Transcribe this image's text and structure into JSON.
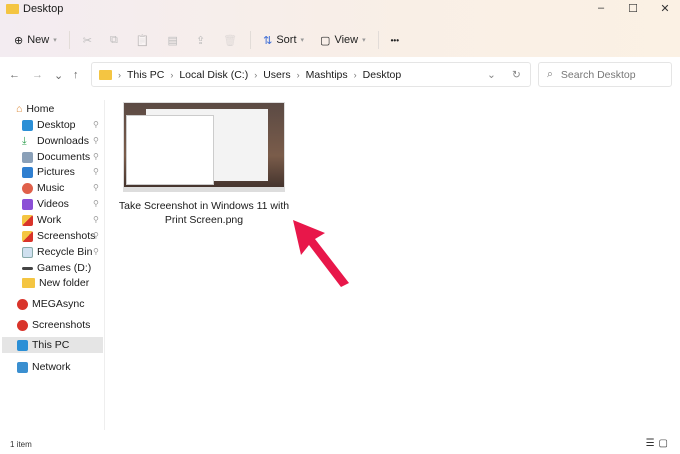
{
  "window": {
    "title": "Desktop",
    "minimize": "–",
    "maximize": "☐",
    "close": "✕"
  },
  "toolbar": {
    "new_label": "New",
    "sort_label": "Sort",
    "view_label": "View",
    "more": "•••",
    "cut": "✂",
    "copy": "⧉",
    "paste": "📋",
    "rename": "▤",
    "share": "⇪",
    "delete": "🗑"
  },
  "nav": {
    "back": "←",
    "forward": "→",
    "recent": "⌄",
    "up": "↑"
  },
  "address": {
    "crumbs": [
      "This PC",
      "Local Disk (C:)",
      "Users",
      "Mashtips",
      "Desktop"
    ],
    "dropdown": "⌄",
    "refresh": "↻"
  },
  "search": {
    "placeholder": "Search Desktop"
  },
  "sidebar": {
    "items": [
      {
        "label": "Home",
        "pinned": false
      },
      {
        "label": "Desktop",
        "pinned": true
      },
      {
        "label": "Downloads",
        "pinned": true
      },
      {
        "label": "Documents",
        "pinned": true
      },
      {
        "label": "Pictures",
        "pinned": true
      },
      {
        "label": "Music",
        "pinned": true
      },
      {
        "label": "Videos",
        "pinned": true
      },
      {
        "label": "Work",
        "pinned": true
      },
      {
        "label": "Screenshots",
        "pinned": true
      },
      {
        "label": "Recycle Bin",
        "pinned": true
      },
      {
        "label": "Games (D:)",
        "pinned": false
      },
      {
        "label": "New folder",
        "pinned": false
      },
      {
        "label": "MEGAsync",
        "pinned": false
      },
      {
        "label": "Screenshots",
        "pinned": false
      },
      {
        "label": "This PC",
        "pinned": false,
        "selected": true
      },
      {
        "label": "Network",
        "pinned": false
      }
    ],
    "pin_glyph": "📌"
  },
  "files": [
    {
      "name": "Take Screenshot in Windows 11 with Print Screen.png"
    }
  ],
  "status": {
    "count": "1 item"
  },
  "colors": {
    "arrow": "#e8174a",
    "selected": "#e5e5e5"
  }
}
